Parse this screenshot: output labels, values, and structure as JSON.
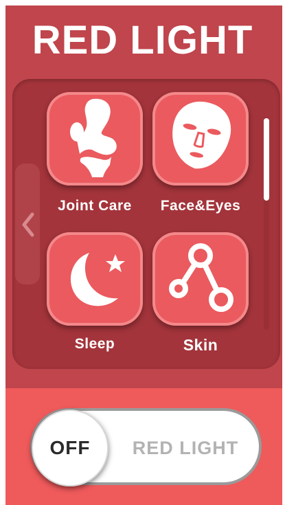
{
  "header": {
    "title": "RED LIGHT"
  },
  "modes": [
    {
      "label": "Joint Care",
      "icon": "knee-joint-icon"
    },
    {
      "label": "Face&Eyes",
      "icon": "face-mask-icon"
    },
    {
      "label": "Sleep",
      "icon": "moon-star-icon"
    },
    {
      "label": "Skin",
      "icon": "skin-nodes-icon"
    }
  ],
  "nav": {
    "prev_icon": "chevron-left-icon"
  },
  "power_toggle": {
    "state_label": "OFF",
    "name": "RED LIGHT"
  },
  "colors": {
    "panel": "#c0454c",
    "grid_bg": "#a3343b",
    "tile": "#ea5a5e",
    "bottom": "#ef5a5b",
    "text": "#ffffff"
  }
}
